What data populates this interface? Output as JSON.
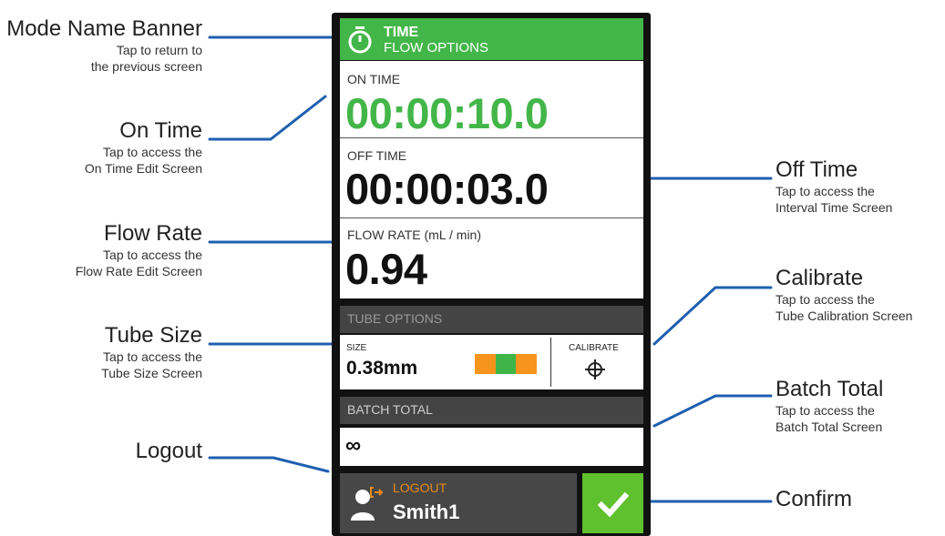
{
  "banner": {
    "title": "TIME",
    "subtitle": "FLOW OPTIONS",
    "icon": "stopwatch-icon"
  },
  "on_time": {
    "label": "ON TIME",
    "value": "00:00:10.0"
  },
  "off_time": {
    "label": "OFF TIME",
    "value": "00:00:03.0"
  },
  "flow_rate": {
    "label": "FLOW RATE (mL / min)",
    "value": "0.94"
  },
  "tube": {
    "header": "TUBE OPTIONS",
    "size_label": "SIZE",
    "size_value": "0.38mm",
    "swatch_colors": [
      "#f7941d",
      "#3fb549",
      "#f7941d"
    ],
    "calibrate_label": "CALIBRATE",
    "calibrate_icon": "crosshair-icon"
  },
  "batch": {
    "header": "BATCH TOTAL",
    "value": "∞"
  },
  "logout": {
    "label": "LOGOUT",
    "user": "Smith1",
    "icon": "user-logout-icon"
  },
  "confirm": {
    "icon": "checkmark-icon"
  },
  "callouts": {
    "mode_banner": {
      "title": "Mode Name Banner",
      "desc1": "Tap to return to",
      "desc2": "the previous screen"
    },
    "on_time": {
      "title": "On Time",
      "desc1": "Tap to access the",
      "desc2": "On Time Edit Screen"
    },
    "flow_rate": {
      "title": "Flow Rate",
      "desc1": "Tap to access the",
      "desc2": "Flow Rate Edit Screen"
    },
    "tube_size": {
      "title": "Tube Size",
      "desc1": "Tap to access the",
      "desc2": "Tube Size Screen"
    },
    "logout": {
      "title": "Logout"
    },
    "off_time": {
      "title": "Off Time",
      "desc1": "Tap to access the",
      "desc2": "Interval Time Screen"
    },
    "calibrate": {
      "title": "Calibrate",
      "desc1": "Tap to access the",
      "desc2": "Tube Calibration Screen"
    },
    "batch_total": {
      "title": "Batch Total",
      "desc1": "Tap to access the",
      "desc2": "Batch Total Screen"
    },
    "confirm": {
      "title": "Confirm"
    }
  },
  "colors": {
    "banner_green": "#43b649",
    "on_time_green": "#43b649",
    "confirm_green": "#5fc12e",
    "logout_orange": "#e88a1a",
    "callout_line_blue": "#1f5fb0",
    "section_header": "#444444"
  }
}
